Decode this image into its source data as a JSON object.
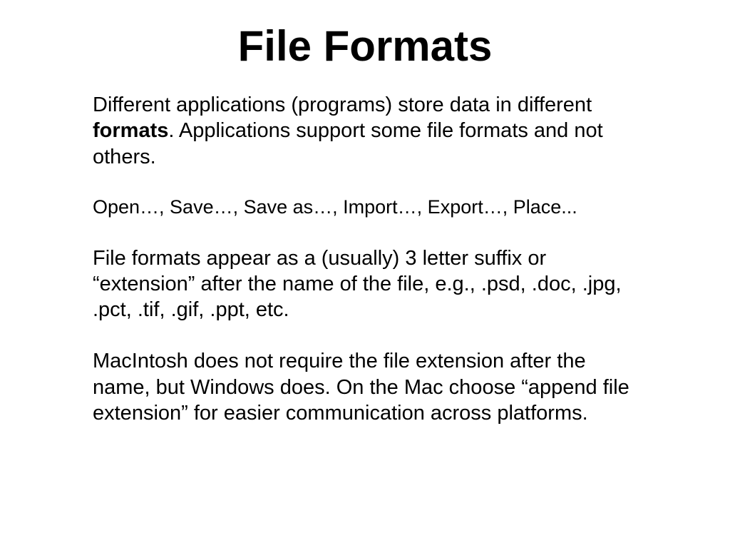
{
  "slide": {
    "title": "File Formats",
    "para1_part1": "Different applications (programs) store data in different ",
    "para1_bold": "formats",
    "para1_part2": ".  Applications support some file formats and not others.",
    "para2": "Open…, Save…, Save as…, Import…, Export…, Place...",
    "para3": "File formats appear as a (usually) 3 letter suffix or “extension” after the name of the file, e.g., .psd, .doc, .jpg, .pct, .tif, .gif, .ppt, etc.",
    "para4": "MacIntosh does not require the file extension after the name, but Windows does.  On the Mac choose “append file extension” for easier communication across platforms."
  }
}
